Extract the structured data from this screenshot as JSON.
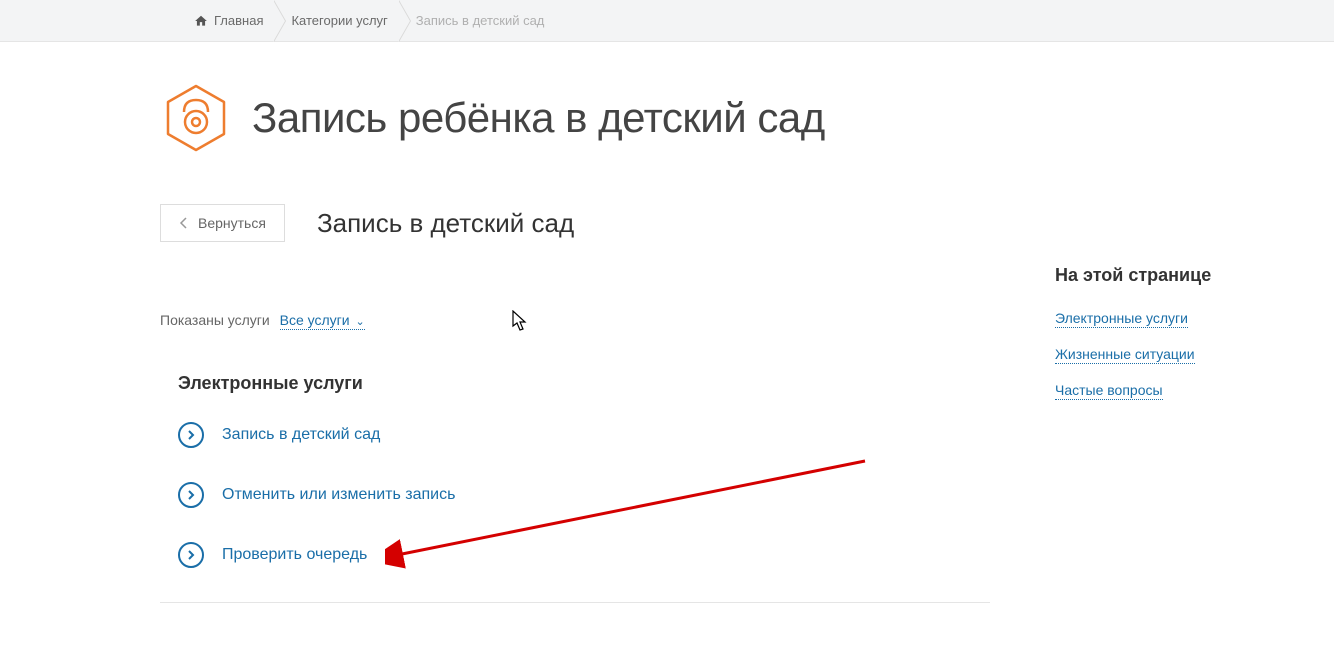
{
  "breadcrumb": {
    "home": "Главная",
    "categories": "Категории услуг",
    "current": "Запись в детский сад"
  },
  "header": {
    "title": "Запись ребёнка в детский сад"
  },
  "subheader": {
    "back_label": "Вернуться",
    "title": "Запись в детский сад"
  },
  "filter": {
    "label": "Показаны услуги",
    "selected": "Все услуги"
  },
  "section": {
    "heading": "Электронные услуги",
    "items": [
      {
        "label": "Запись в детский сад"
      },
      {
        "label": "Отменить или изменить запись"
      },
      {
        "label": "Проверить очередь"
      }
    ]
  },
  "sidebar": {
    "heading": "На этой странице",
    "links": [
      {
        "label": "Электронные услуги"
      },
      {
        "label": "Жизненные ситуации"
      },
      {
        "label": "Частые вопросы"
      }
    ]
  }
}
